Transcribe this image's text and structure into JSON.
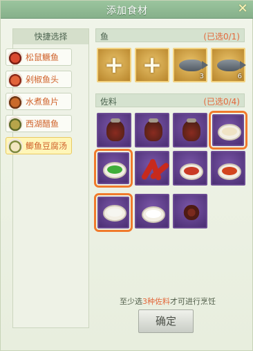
{
  "window": {
    "title": "添加食材",
    "close_icon": "close-icon"
  },
  "sidebar": {
    "header": "快捷选择",
    "items": [
      {
        "label": "松鼠鳜鱼",
        "icon": "dish-icon",
        "active": false
      },
      {
        "label": "剁椒鱼头",
        "icon": "dish-icon",
        "active": false
      },
      {
        "label": "水煮鱼片",
        "icon": "dish-icon",
        "active": false
      },
      {
        "label": "西湖醋鱼",
        "icon": "dish-icon",
        "active": false
      },
      {
        "label": "鲫鱼豆腐汤",
        "icon": "dish-icon",
        "active": true
      }
    ]
  },
  "fish_section": {
    "name": "鱼",
    "count": "(已选0/1)",
    "slots": [
      {
        "type": "empty",
        "icon": "plus-icon"
      },
      {
        "type": "empty",
        "icon": "plus-icon"
      },
      {
        "type": "fish",
        "icon": "fish-icon",
        "qty": "3"
      },
      {
        "type": "fish",
        "icon": "fish-icon",
        "qty": "6"
      }
    ]
  },
  "seasoning_section": {
    "name": "佐料",
    "count": "(已选0/4)",
    "items": [
      {
        "icon": "sauce-jar-icon",
        "highlighted": false
      },
      {
        "icon": "sauce-jar-icon",
        "highlighted": false
      },
      {
        "icon": "sauce-jar-icon",
        "highlighted": false
      },
      {
        "icon": "flour-bowl-icon",
        "highlighted": true
      },
      {
        "icon": "scallion-bowl-icon",
        "highlighted": true
      },
      {
        "icon": "chili-pepper-icon",
        "highlighted": false
      },
      {
        "icon": "chili-sauce-bowl-icon",
        "highlighted": false
      },
      {
        "icon": "chili-oil-bowl-icon",
        "highlighted": false
      },
      {
        "icon": "tofu-bowl-icon",
        "highlighted": true
      },
      {
        "icon": "sugar-bowl-icon",
        "highlighted": false
      },
      {
        "icon": "sichuan-pepper-icon",
        "highlighted": false
      }
    ]
  },
  "hint": {
    "prefix": "至少选",
    "emphasis": "3种佐料",
    "suffix": "才可进行烹饪"
  },
  "confirm_button": "确定",
  "colors": {
    "accent": "#e3683b",
    "highlight": "#f07a2c",
    "title_bar": "#8fb893"
  }
}
